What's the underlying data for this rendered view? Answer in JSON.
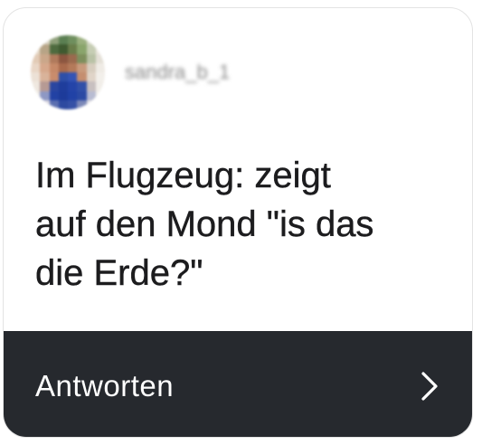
{
  "post": {
    "username": "sandra_b_1",
    "avatar_icon": "profile-photo-icon",
    "message": "Im Flugzeug: zeigt\nauf den Mond \"is das\ndie Erde?\""
  },
  "reply": {
    "label": "Antworten",
    "chevron_icon": "chevron-right-icon"
  },
  "colors": {
    "card_border": "#e3e3e3",
    "text": "#1c1c1e",
    "reply_bar": "#26292e",
    "reply_text": "#ffffff"
  }
}
